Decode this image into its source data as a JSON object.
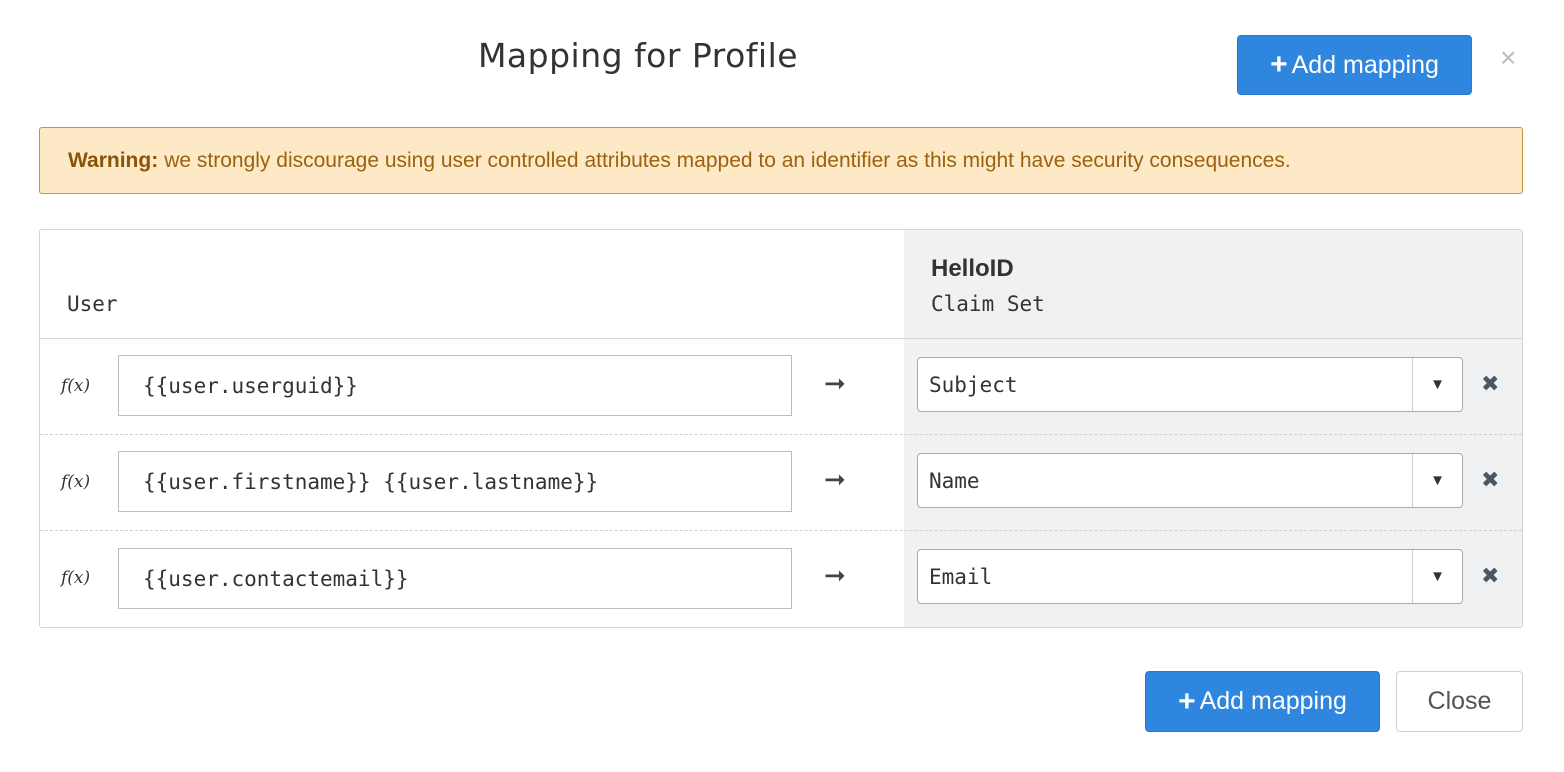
{
  "modal": {
    "title": "Mapping for Profile",
    "add_mapping_label": "Add mapping",
    "close_icon": "×"
  },
  "warning": {
    "label": "Warning:",
    "text": "we strongly discourage using user controlled attributes mapped to an identifier as this might have security consequences."
  },
  "table": {
    "source_header": "User",
    "target_header": {
      "name": "HelloID",
      "sub": "Claim Set"
    },
    "rows": [
      {
        "fx": "f(x)",
        "expression": "{{user.userguid}}",
        "arrow": "➞",
        "target": "Subject",
        "remove": "✖"
      },
      {
        "fx": "f(x)",
        "expression": "{{user.firstname}} {{user.lastname}}",
        "arrow": "➞",
        "target": "Name",
        "remove": "✖"
      },
      {
        "fx": "f(x)",
        "expression": "{{user.contactemail}}",
        "arrow": "➞",
        "target": "Email",
        "remove": "✖"
      }
    ]
  },
  "footer": {
    "add_mapping_label": "Add mapping",
    "close_label": "Close"
  },
  "icons": {
    "plus": "plus-icon",
    "close": "close-icon",
    "arrow": "arrow-right-icon",
    "caret": "caret-down-icon",
    "remove": "remove-icon"
  },
  "colors": {
    "primary": "#2e86de",
    "warning_bg": "#fde9c6",
    "warning_text": "#9b6210",
    "target_bg": "#f0f1f2"
  }
}
